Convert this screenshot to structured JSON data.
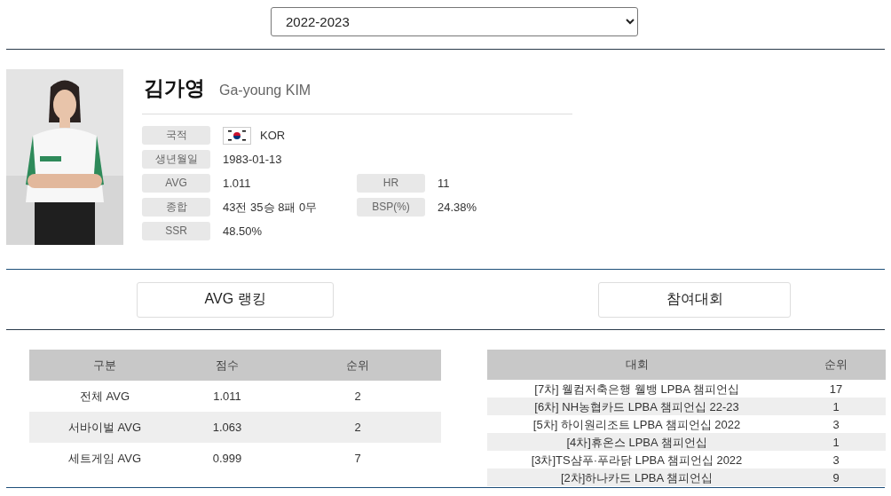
{
  "season_select": {
    "value": "2022-2023"
  },
  "player": {
    "name": "김가영",
    "name_en": "Ga-young KIM",
    "info": [
      {
        "label": "국적",
        "value": "KOR",
        "flag": true
      },
      {
        "label": "생년월일",
        "value": "1983-01-13"
      },
      {
        "label": "AVG",
        "value": "1.011",
        "label2": "HR",
        "value2": "11"
      },
      {
        "label": "종합",
        "value": "43전 35승 8패 0무",
        "label2": "BSP(%)",
        "value2": "24.38%"
      },
      {
        "label": "SSR",
        "value": "48.50%"
      }
    ]
  },
  "tabs": [
    {
      "label": "AVG 랭킹"
    },
    {
      "label": "참여대회"
    }
  ],
  "avg_table": {
    "columns": [
      "구분",
      "점수",
      "순위"
    ],
    "rows": [
      [
        "전체 AVG",
        "1.011",
        "2"
      ],
      [
        "서바이벌 AVG",
        "1.063",
        "2"
      ],
      [
        "세트게임 AVG",
        "0.999",
        "7"
      ]
    ]
  },
  "tournament_table": {
    "columns": [
      "대회",
      "순위"
    ],
    "rows": [
      [
        "[7차] 웰컴저축은행 웰뱅 LPBA 챔피언십",
        "17"
      ],
      [
        "[6차] NH농협카드 LPBA 챔피언십 22-23",
        "1"
      ],
      [
        "[5차] 하이원리조트 LPBA 챔피언십 2022",
        "3"
      ],
      [
        "[4차]휴온스 LPBA 챔피언십",
        "1"
      ],
      [
        "[3차]TS샴푸·푸라닭 LPBA 챔피언십 2022",
        "3"
      ],
      [
        "[2차]하나카드 LPBA 챔피언십",
        "9"
      ]
    ]
  }
}
